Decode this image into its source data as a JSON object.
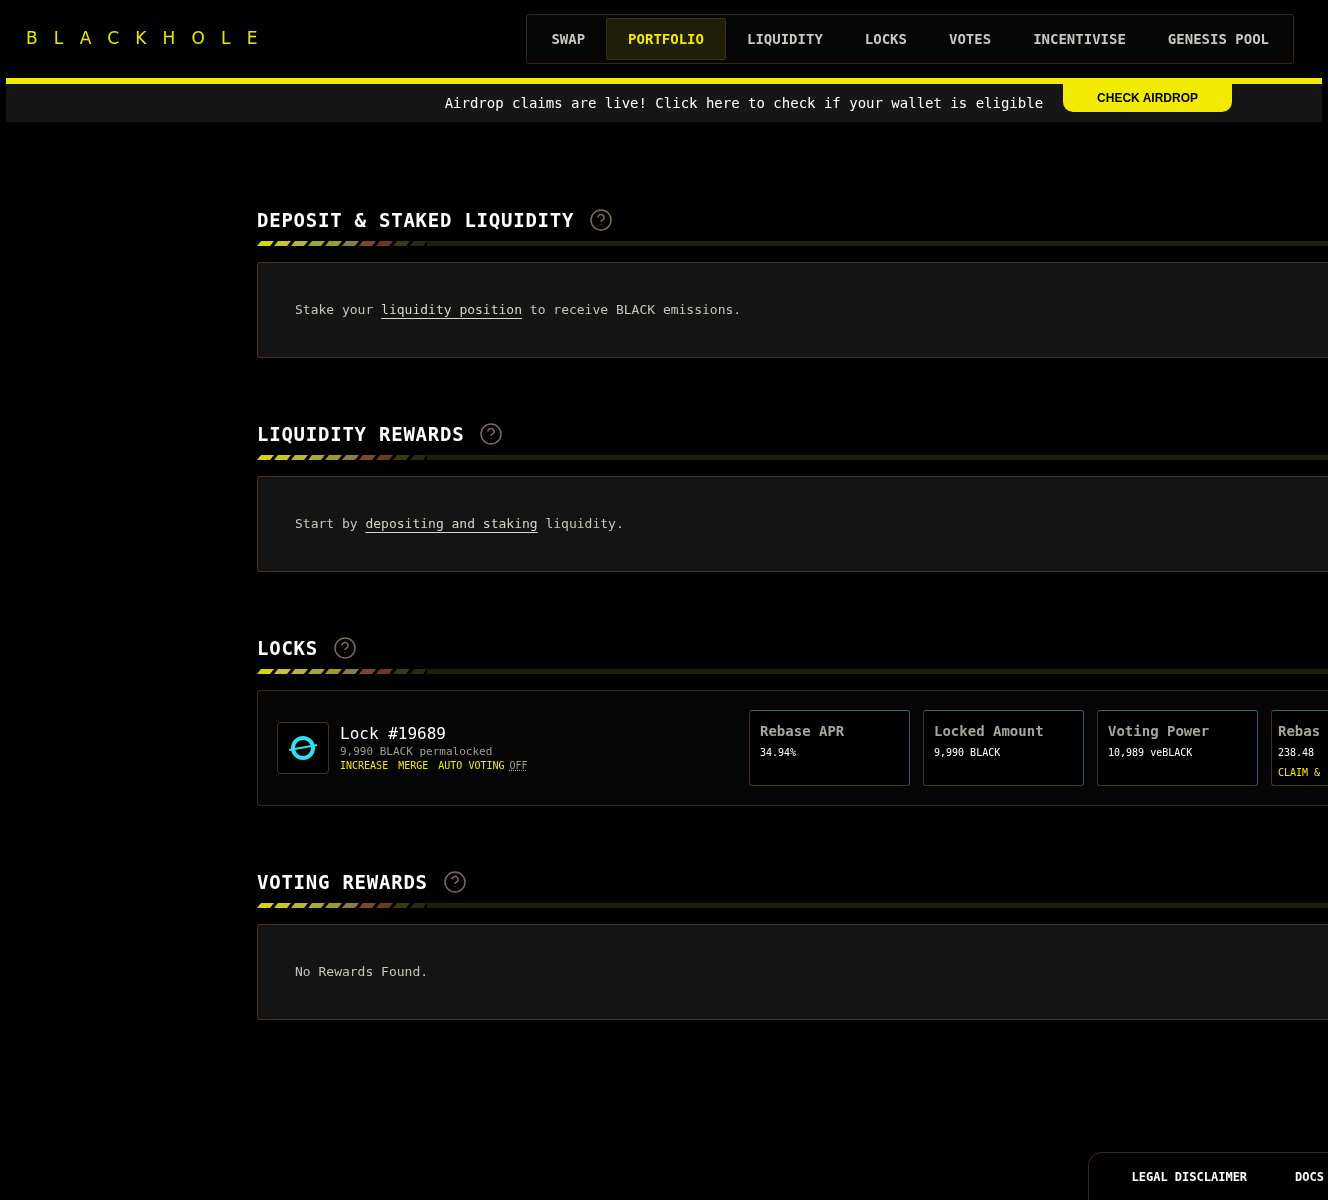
{
  "logo": {
    "text": "BLACKHOLE"
  },
  "nav": [
    {
      "label": "SWAP",
      "selected": false
    },
    {
      "label": "PORTFOLIO",
      "selected": true
    },
    {
      "label": "LIQUIDITY",
      "selected": false
    },
    {
      "label": "LOCKS",
      "selected": false
    },
    {
      "label": "VOTES",
      "selected": false
    },
    {
      "label": "INCENTIVISE",
      "selected": false
    },
    {
      "label": "GENESIS POOL",
      "selected": false
    }
  ],
  "banner": {
    "text": "Airdrop claims are live! Click here to check if your wallet is eligible",
    "button": "CHECK AIRDROP"
  },
  "sections": [
    {
      "kind": "message",
      "title": "DEPOSIT & STAKED LIQUIDITY",
      "before": "Stake your",
      "link": "liquidity position",
      "after": "to receive BLACK emissions."
    },
    {
      "kind": "message",
      "title": "LIQUIDITY REWARDS",
      "before": "Start by",
      "link": "depositing and staking",
      "after": "liquidity."
    },
    {
      "kind": "lock",
      "title": "LOCKS",
      "lock": {
        "name": "Lock #19689",
        "amount": "9,990 BLACK permalocked",
        "actions": [
          "INCREASE",
          "MERGE"
        ],
        "auto_voting_label": "AUTO VOTING",
        "auto_voting_value": "OFF",
        "stats": [
          {
            "label": "Rebase APR",
            "value": "34.94%"
          },
          {
            "label": "Locked Amount",
            "value": "9,990 BLACK"
          },
          {
            "label": "Voting Power",
            "value": "10,989 veBLACK"
          },
          {
            "label": "Rebas",
            "value": "238.48",
            "action": "CLAIM &"
          }
        ]
      }
    },
    {
      "kind": "message",
      "title": "VOTING REWARDS",
      "before": "No Rewards Found."
    }
  ],
  "footer": {
    "links": [
      "LEGAL DISCLAIMER",
      "DOCS"
    ]
  }
}
